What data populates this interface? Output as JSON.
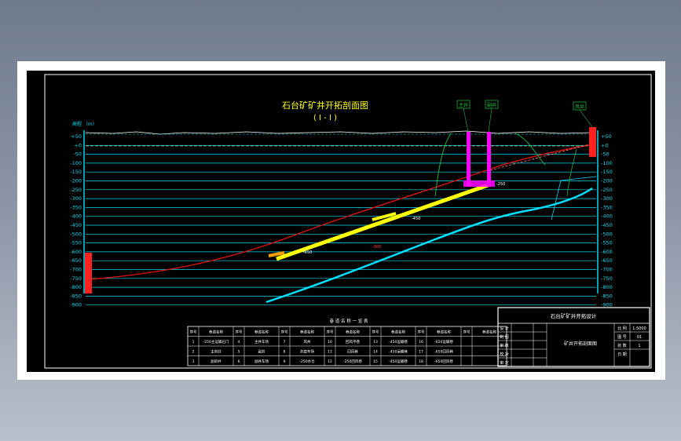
{
  "title": "石台矿矿井开拓剖面图",
  "subtitle": "( I - I )",
  "axis_note": "高程 （m）",
  "elevation_labels": [
    "+50",
    "+0",
    "-50",
    "-100",
    "-150",
    "-200",
    "-250",
    "-300",
    "-350",
    "-400",
    "-450",
    "-500",
    "-550",
    "-600",
    "-650",
    "-700",
    "-750",
    "-800",
    "-850",
    "-900"
  ],
  "shaft_labels": [
    "主井",
    "副井",
    "风井"
  ],
  "seam_labels": [
    "-250",
    "-450",
    "-650",
    "-300"
  ],
  "table_caption": "巷 道 名 称 一 览 表",
  "roadway_table": {
    "headers": [
      "序号",
      "巷道名称",
      "序号",
      "巷道名称",
      "序号",
      "巷道名称",
      "序号",
      "巷道名称",
      "序号",
      "巷道名称",
      "序号",
      "巷道名称",
      "序号",
      "巷道名称"
    ],
    "rows": [
      [
        "1",
        "-250主运输石门",
        "4",
        "主井车场",
        "7",
        "风井",
        "10",
        "回风平巷",
        "13",
        "-450运输巷",
        "16",
        "-650运输巷",
        "",
        ""
      ],
      [
        "2",
        "主斜井",
        "5",
        "副井",
        "8",
        "井底车场",
        "11",
        "回风巷",
        "14",
        "-450运输巷",
        "17",
        "-650回风巷",
        "",
        ""
      ],
      [
        "3",
        "副斜井",
        "6",
        "副井车场",
        "9",
        "-250水仓",
        "12",
        "-250回风巷",
        "15",
        "-450运输巷",
        "18",
        "-650回风巷",
        "",
        ""
      ]
    ]
  },
  "title_block": {
    "project": "石台矿矿井开拓设计",
    "drawing_name": "矿井开拓剖面图",
    "roles": [
      "设 计",
      "制 图",
      "审 核",
      "校 对",
      "审 定"
    ],
    "scale_label": "比 例",
    "scale_value": "1:5000",
    "sheet_label": "图 号",
    "sheet_value": "01",
    "sheets_label": "张 数",
    "sheets_value": "1",
    "date_label": "日 期"
  },
  "colors": {
    "grid": "#00d8f0",
    "seam": "#ffff00",
    "shaft": "#ff00ff",
    "fault": "#e01010",
    "contour": "#20c040"
  }
}
